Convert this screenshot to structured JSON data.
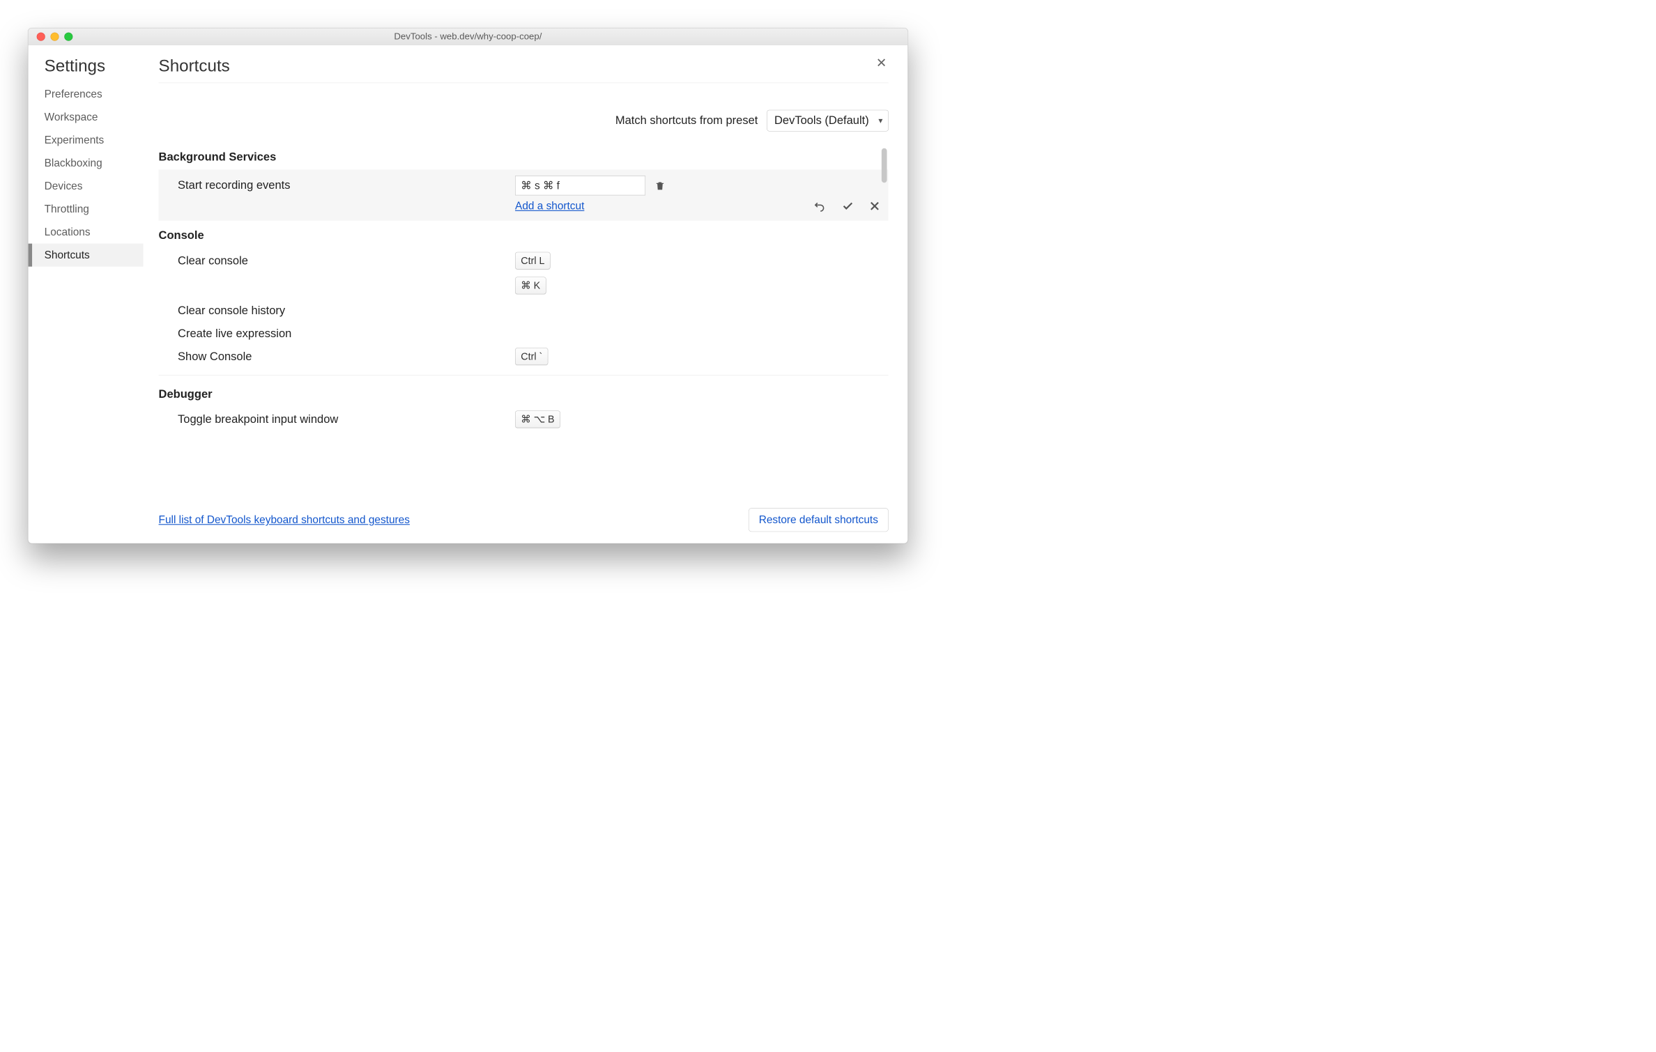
{
  "window": {
    "title": "DevTools - web.dev/why-coop-coep/"
  },
  "sidebar": {
    "title": "Settings",
    "items": [
      {
        "label": "Preferences",
        "active": false
      },
      {
        "label": "Workspace",
        "active": false
      },
      {
        "label": "Experiments",
        "active": false
      },
      {
        "label": "Blackboxing",
        "active": false
      },
      {
        "label": "Devices",
        "active": false
      },
      {
        "label": "Throttling",
        "active": false
      },
      {
        "label": "Locations",
        "active": false
      },
      {
        "label": "Shortcuts",
        "active": true
      }
    ]
  },
  "page": {
    "title": "Shortcuts",
    "preset_label": "Match shortcuts from preset",
    "preset_value": "DevTools (Default)"
  },
  "sections": {
    "bg": {
      "title": "Background Services",
      "editing": {
        "label": "Start recording events",
        "input_value": "⌘ s ⌘ f",
        "add_label": "Add a shortcut"
      }
    },
    "console": {
      "title": "Console",
      "rows": [
        {
          "label": "Clear console",
          "keys": [
            "Ctrl L",
            "⌘ K"
          ]
        },
        {
          "label": "Clear console history",
          "keys": []
        },
        {
          "label": "Create live expression",
          "keys": []
        },
        {
          "label": "Show Console",
          "keys": [
            "Ctrl `"
          ]
        }
      ]
    },
    "debugger": {
      "title": "Debugger",
      "rows": [
        {
          "label": "Toggle breakpoint input window",
          "keys": [
            "⌘ ⌥ B"
          ]
        }
      ]
    }
  },
  "footer": {
    "link": "Full list of DevTools keyboard shortcuts and gestures",
    "restore": "Restore default shortcuts"
  }
}
